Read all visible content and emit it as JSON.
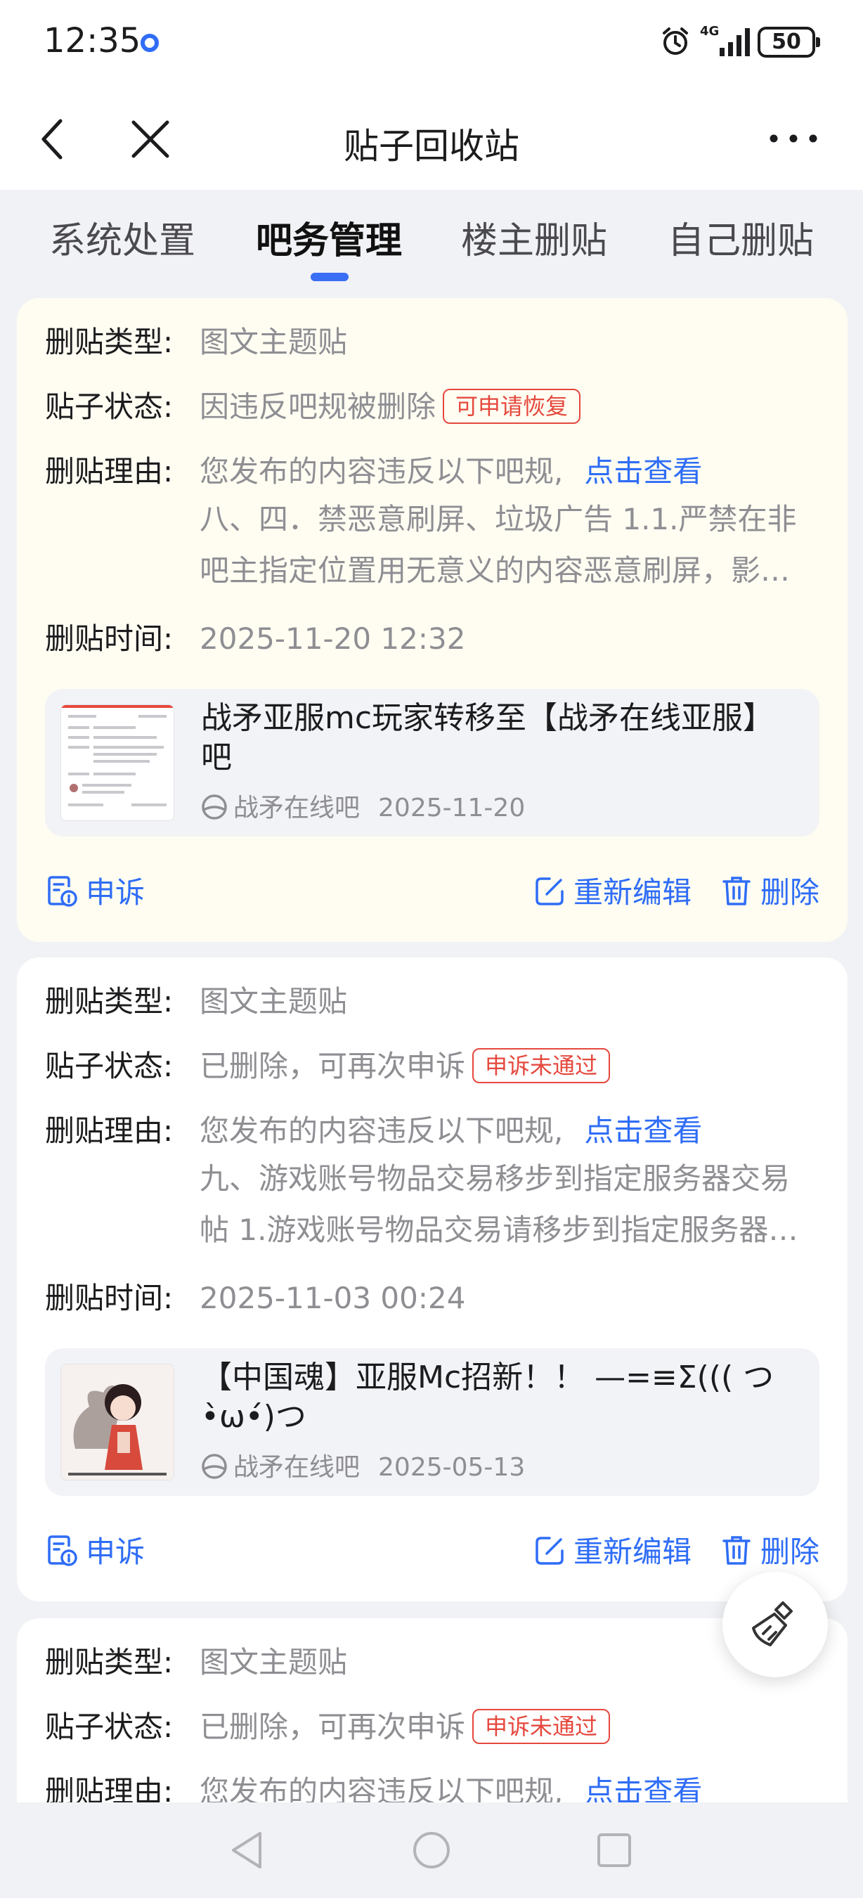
{
  "status_bar": {
    "time": "12:35",
    "network": "4G",
    "battery": "50"
  },
  "nav": {
    "title": "贴子回收站"
  },
  "tabs": [
    {
      "label": "系统处置",
      "active": false
    },
    {
      "label": "吧务管理",
      "active": true
    },
    {
      "label": "楼主删贴",
      "active": false
    },
    {
      "label": "自己删贴",
      "active": false
    }
  ],
  "labels": {
    "type": "删贴类型:",
    "status": "贴子状态:",
    "reason": "删贴理由:",
    "time": "删贴时间:"
  },
  "cards": [
    {
      "type": "图文主题贴",
      "status": "因违反吧规被删除",
      "badge": "可申请恢复",
      "reason": "您发布的内容违反以下吧规,",
      "reason_link": "点击查看",
      "reason_detail": "八、四．禁恶意刷屏、垃圾广告 1.1.严禁在非吧主指定位置用无意义的内容恶意刷屏，影响吧友正常浏览",
      "time": "2025-11-20 12:32",
      "post_title": "战矛亚服mc玩家转移至【战矛在线亚服】吧",
      "post_bar": "战矛在线吧",
      "post_date": "2025-11-20",
      "appeal": "申诉",
      "edit": "重新编辑",
      "delete": "删除"
    },
    {
      "type": "图文主题贴",
      "status": "已删除，可再次申诉",
      "badge": "申诉未通过",
      "reason": "您发布的内容违反以下吧规,",
      "reason_link": "点击查看",
      "reason_detail": "九、游戏账号物品交易移步到指定服务器交易帖 1.游戏账号物品交易请移步到指定服务器交易帖进行",
      "time": "2025-11-03 00:24",
      "post_title": "【中国魂】亚服Mc招新！！ —=≡Σ((( つ•̀ω•́)つ",
      "post_bar": "战矛在线吧",
      "post_date": "2025-05-13",
      "appeal": "申诉",
      "edit": "重新编辑",
      "delete": "删除"
    },
    {
      "type": "图文主题贴",
      "status": "已删除，可再次申诉",
      "badge": "申诉未通过",
      "reason": "您发布的内容违反以下吧规,",
      "reason_link": "点击查看"
    }
  ],
  "colors": {
    "accent": "#2f6df6",
    "badge_red": "#e5483d",
    "first_card_bg": "#fffdf2"
  },
  "icons": {
    "appeal": "document-info-icon",
    "edit": "edit-icon",
    "delete": "trash-icon",
    "fab": "broom-icon"
  }
}
